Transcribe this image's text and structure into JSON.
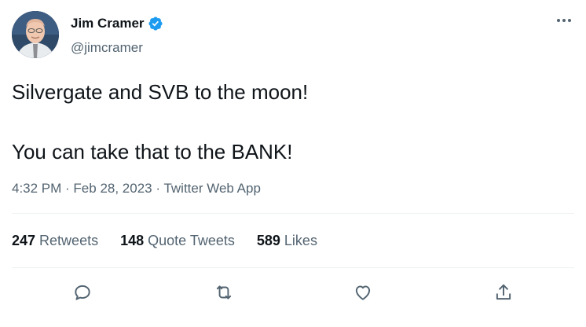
{
  "author": {
    "display_name": "Jim Cramer",
    "handle": "@jimcramer",
    "verified": true
  },
  "tweet": {
    "line1": "Silvergate and SVB to the moon!",
    "line2": "You can take that to the BANK!"
  },
  "meta": {
    "time": "4:32 PM",
    "sep1": " · ",
    "date": "Feb 28, 2023",
    "sep2": " · ",
    "source": "Twitter Web App"
  },
  "stats": [
    {
      "value": "247",
      "label": "Retweets"
    },
    {
      "value": "148",
      "label": "Quote Tweets"
    },
    {
      "value": "589",
      "label": "Likes"
    }
  ],
  "icons": {
    "reply": "reply-icon",
    "retweet": "retweet-icon",
    "like": "heart-icon",
    "share": "share-icon",
    "more": "more-options-icon",
    "verified": "verified-badge-icon"
  },
  "colors": {
    "text": "#0f1419",
    "secondary": "#536471",
    "verified": "#1d9bf0",
    "divider": "#eff3f4"
  }
}
